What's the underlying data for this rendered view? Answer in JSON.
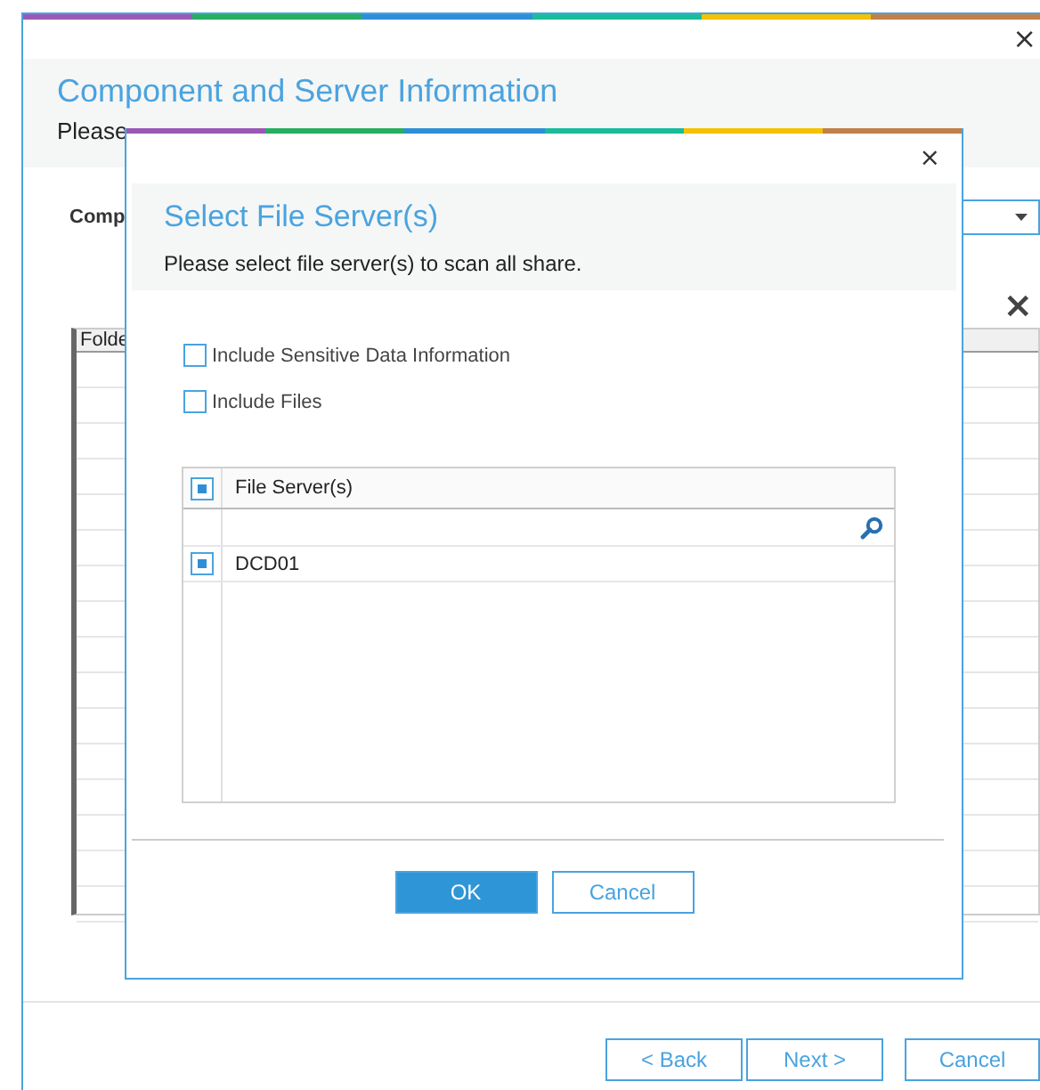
{
  "window": {
    "title": "Component and Server Information",
    "subtitle": "Please",
    "close": "×",
    "component_label": "Comp",
    "clear": "×",
    "table": {
      "columns": [
        "Folde"
      ]
    },
    "buttons": [
      {
        "label": "< Back",
        "kind": "secondary"
      },
      {
        "label": "Next >",
        "kind": "secondary"
      },
      {
        "label": "Cancel",
        "kind": "cancel"
      }
    ]
  },
  "dialog": {
    "close": "×",
    "title": "Select File Server(s)",
    "subtitle": "Please select file server(s) to scan all share.",
    "options": [
      {
        "label": "Include Sensitive Data Information",
        "checked": false
      },
      {
        "label": "Include Files",
        "checked": false
      }
    ],
    "grid": {
      "header": {
        "label": "File Server(s)",
        "checked": true
      },
      "rows": [
        {
          "label": "DCD01",
          "checked": true
        }
      ]
    },
    "buttons": [
      {
        "label": "OK",
        "kind": "primary"
      },
      {
        "label": "Cancel",
        "kind": "secondary"
      }
    ]
  }
}
